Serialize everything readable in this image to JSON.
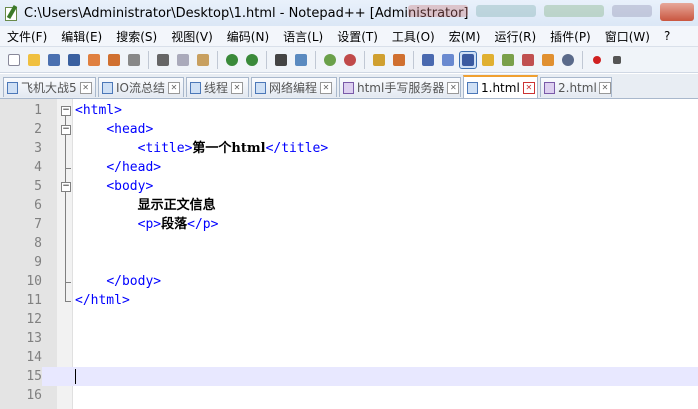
{
  "window": {
    "title": "C:\\Users\\Administrator\\Desktop\\1.html - Notepad++ [Administrator]"
  },
  "menu": [
    {
      "label": "文件(F)"
    },
    {
      "label": "编辑(E)"
    },
    {
      "label": "搜索(S)"
    },
    {
      "label": "视图(V)"
    },
    {
      "label": "编码(N)"
    },
    {
      "label": "语言(L)"
    },
    {
      "label": "设置(T)"
    },
    {
      "label": "工具(O)"
    },
    {
      "label": "宏(M)"
    },
    {
      "label": "运行(R)"
    },
    {
      "label": "插件(P)"
    },
    {
      "label": "窗口(W)"
    },
    {
      "label": "?"
    }
  ],
  "toolbar_icons": [
    "new-file-icon",
    "open-file-icon",
    "save-icon",
    "save-all-icon",
    "close-icon",
    "close-all-icon",
    "print-icon",
    "cut-icon",
    "copy-icon",
    "paste-icon",
    "undo-icon",
    "redo-icon",
    "find-icon",
    "replace-icon",
    "zoom-in-icon",
    "zoom-out-icon",
    "sync-vertical-icon",
    "sync-horizontal-icon",
    "word-wrap-icon",
    "show-all-chars-icon",
    "indent-guide-icon",
    "user-language-icon",
    "doc-map-icon",
    "function-list-icon",
    "folder-as-workspace-icon",
    "monitor-icon",
    "record-macro-icon"
  ],
  "tabs": [
    {
      "label": "飞机大战5",
      "active": false,
      "modified": false
    },
    {
      "label": "IO流总结",
      "active": false,
      "modified": false
    },
    {
      "label": "线程",
      "active": false,
      "modified": false
    },
    {
      "label": "网络编程",
      "active": false,
      "modified": false
    },
    {
      "label": "html手写服务器",
      "active": false,
      "modified": true
    },
    {
      "label": "1.html",
      "active": true,
      "modified": false
    },
    {
      "label": "2.html",
      "active": false,
      "modified": true
    }
  ],
  "editor": {
    "lines": [
      {
        "num": "1",
        "text": "<html>"
      },
      {
        "num": "2",
        "text": "<head>"
      },
      {
        "num": "3",
        "open": "<title>",
        "content": "第一个html",
        "close": "</title>"
      },
      {
        "num": "4",
        "text": "</head>"
      },
      {
        "num": "5",
        "text": "<body>"
      },
      {
        "num": "6",
        "content": "显示正文信息"
      },
      {
        "num": "7",
        "open": "<p>",
        "content": "段落",
        "close": "</p>"
      },
      {
        "num": "8"
      },
      {
        "num": "9"
      },
      {
        "num": "10",
        "text": "</body>"
      },
      {
        "num": "11",
        "text": "</html>"
      },
      {
        "num": "12"
      },
      {
        "num": "13"
      },
      {
        "num": "14"
      },
      {
        "num": "15"
      },
      {
        "num": "16"
      }
    ],
    "current_line": 15
  }
}
